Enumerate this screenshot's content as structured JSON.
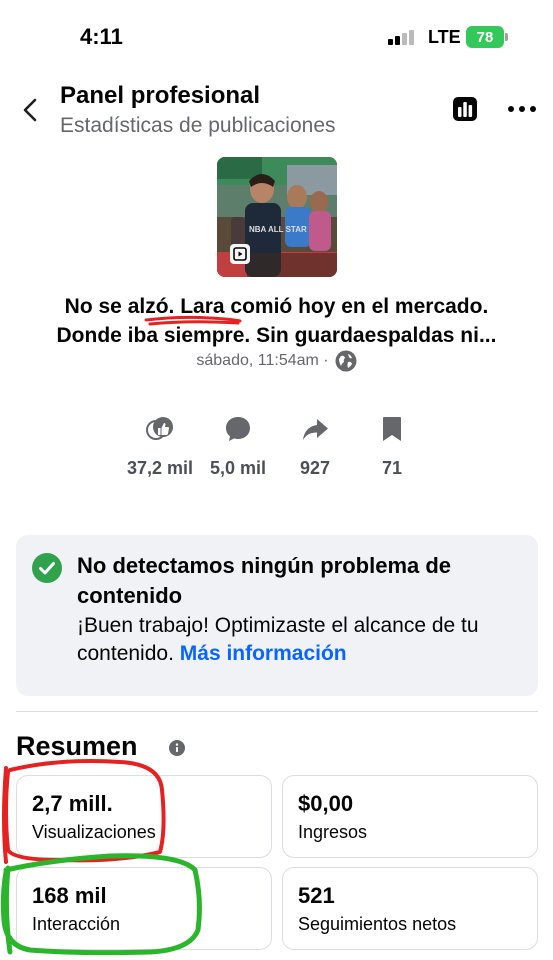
{
  "status_bar": {
    "time": "4:11",
    "network": "LTE",
    "battery": "78"
  },
  "header": {
    "title": "Panel profesional",
    "subtitle": "Estadísticas de publicaciones"
  },
  "post": {
    "thumbnail_text": "NBA ALL STAR",
    "caption_line1": "No se alzó. Lara comió hoy en el mercado.",
    "caption_line2": "Donde iba siempre. Sin guardaespaldas ni...",
    "timestamp": "sábado, 11:54am ·"
  },
  "stats": [
    {
      "icon": "reactions-icon",
      "value": "37,2 mil"
    },
    {
      "icon": "comment-icon",
      "value": "5,0 mil"
    },
    {
      "icon": "share-icon",
      "value": "927"
    },
    {
      "icon": "bookmark-icon",
      "value": "71"
    }
  ],
  "notice": {
    "title": "No detectamos ningún problema de contenido",
    "body": "¡Buen trabajo! Optimizaste el alcance de tu contenido.",
    "link": "Más información",
    "color": "#31a24c"
  },
  "summary": {
    "title": "Resumen",
    "cards": [
      {
        "value": "2,7 mill.",
        "label": "Visualizaciones"
      },
      {
        "value": "$0,00",
        "label": "Ingresos"
      },
      {
        "value": "168 mil",
        "label": "Interacción"
      },
      {
        "value": "521",
        "label": "Seguimientos netos"
      }
    ]
  },
  "colors": {
    "accent": "#0866ff",
    "annotation_red": "#e52222",
    "annotation_green": "#2bb52b"
  }
}
